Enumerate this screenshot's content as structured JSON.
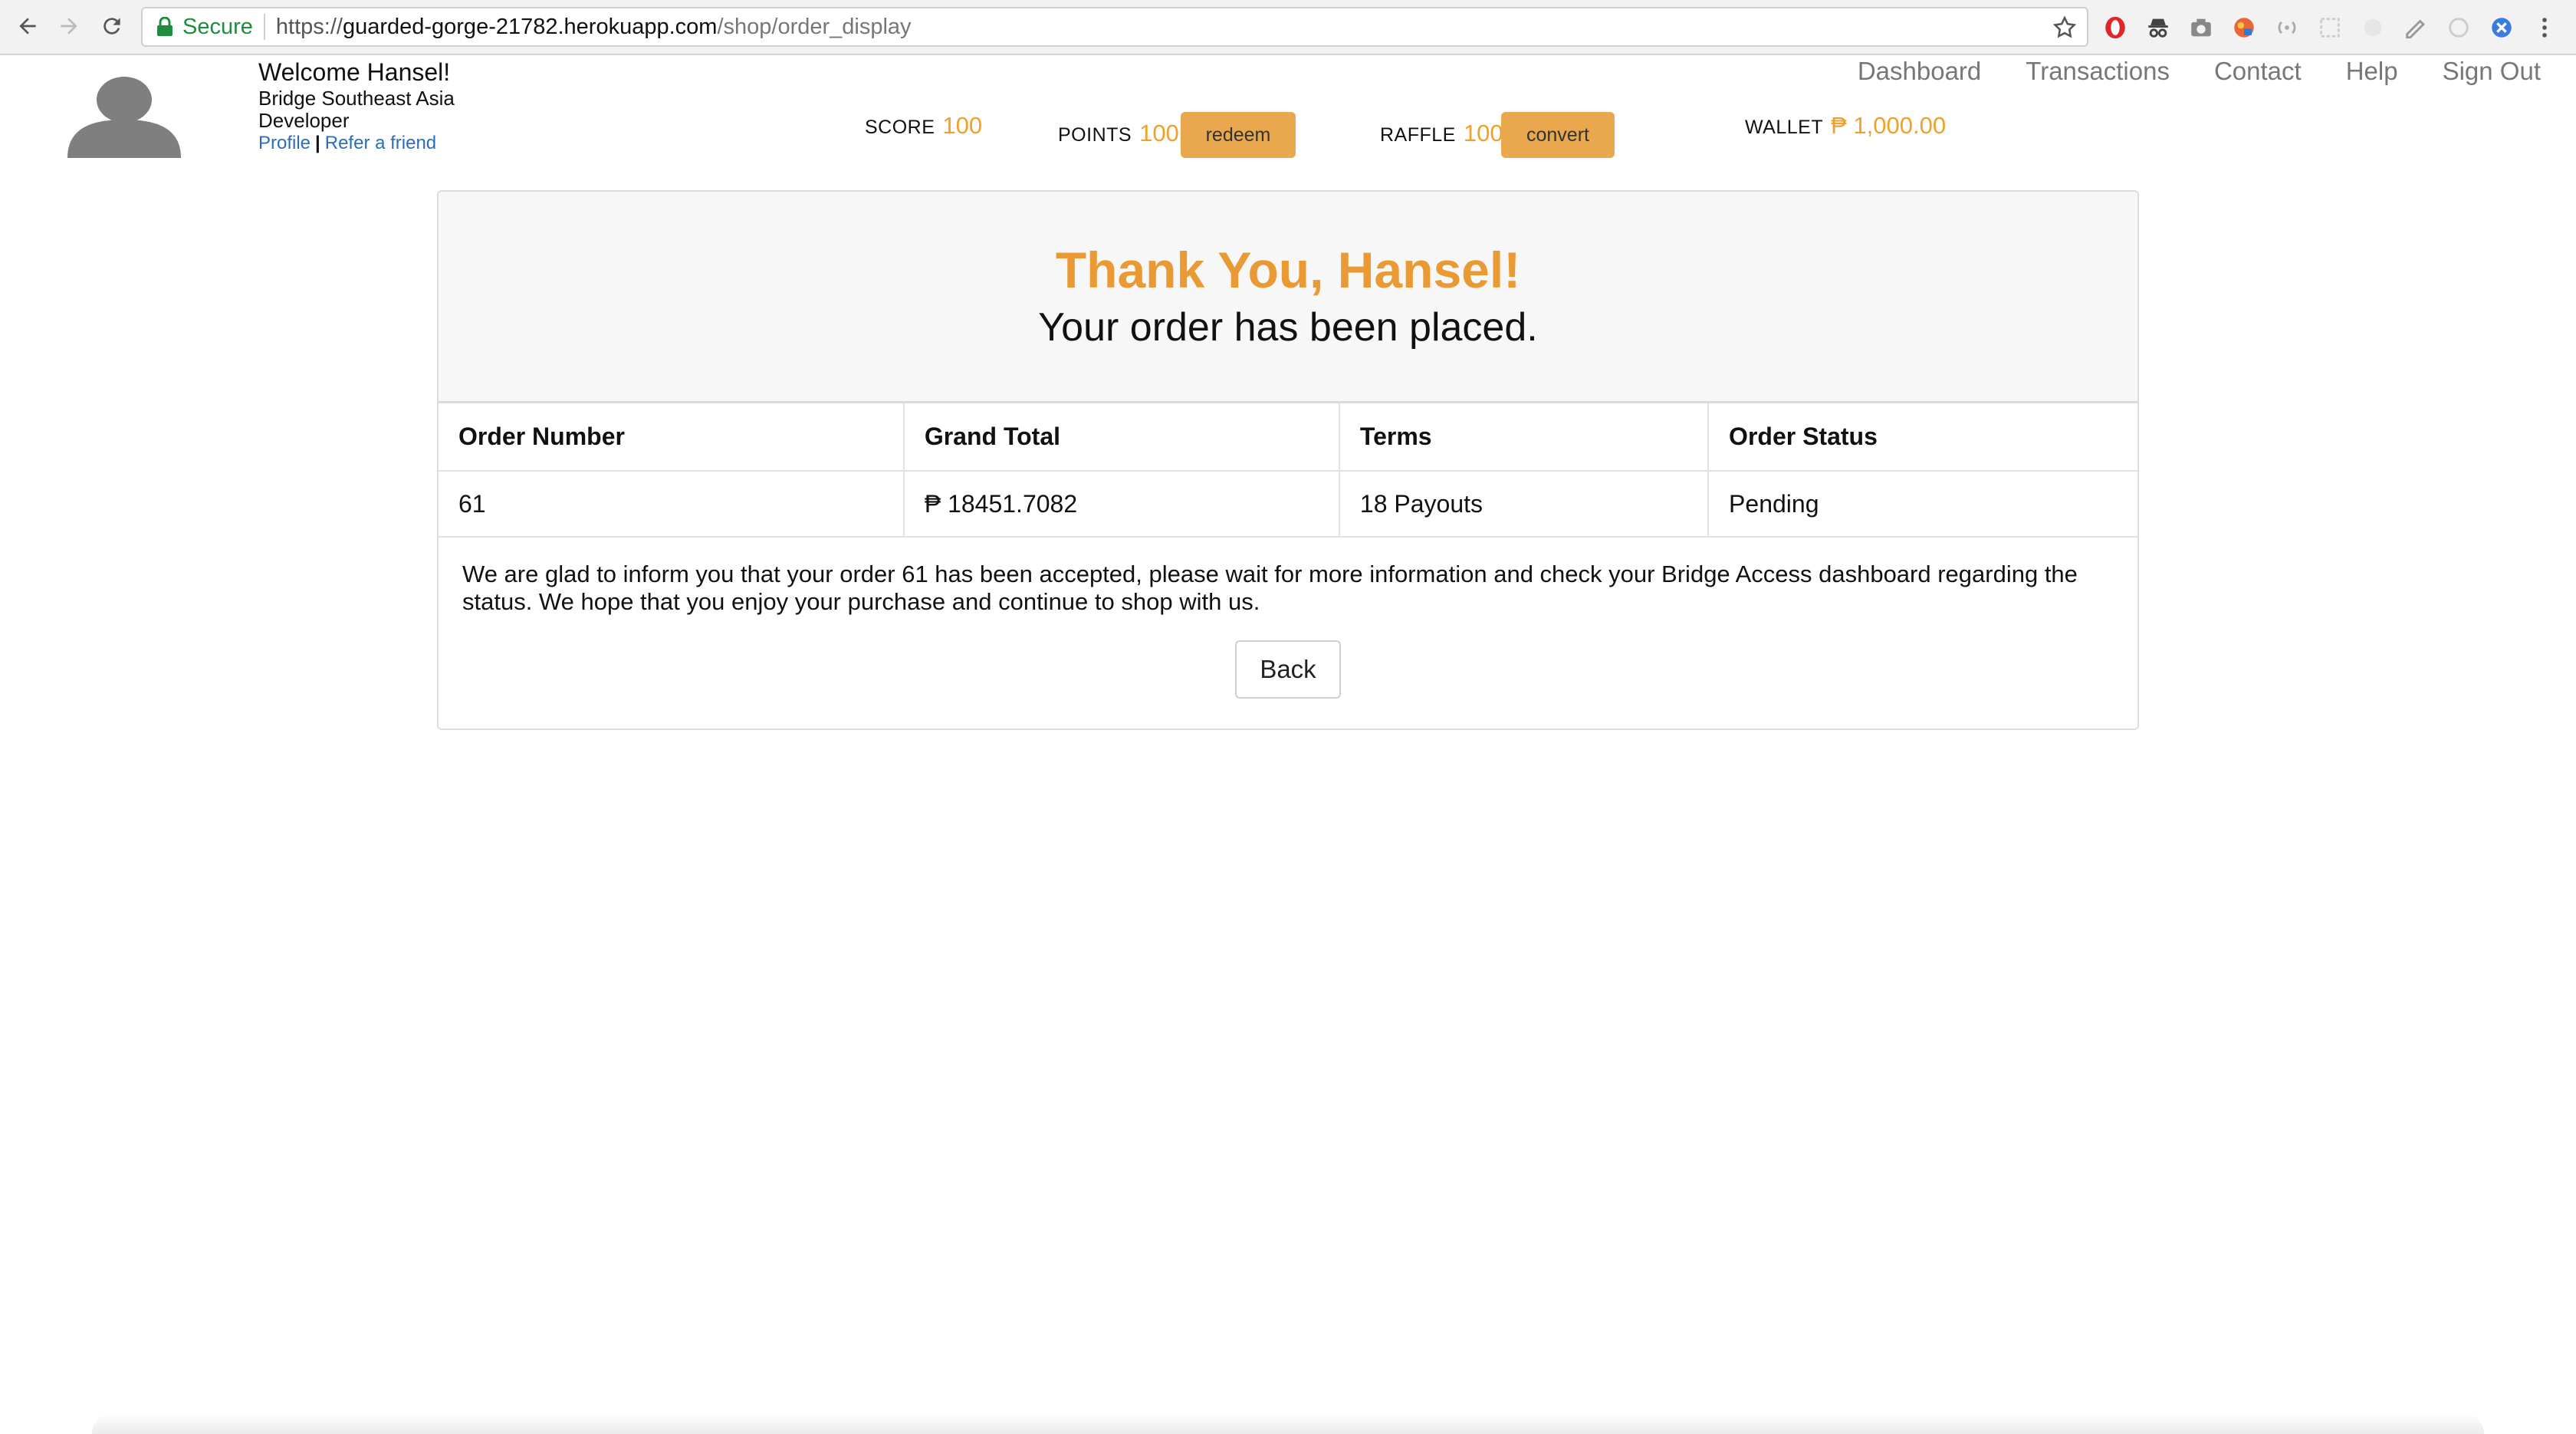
{
  "browser": {
    "secure_label": "Secure",
    "url_scheme": "https://",
    "url_host": "guarded-gorge-21782.herokuapp.com",
    "url_path": "/shop/order_display"
  },
  "header": {
    "welcome": "Welcome Hansel!",
    "company": "Bridge Southeast Asia",
    "role": "Developer",
    "profile_link": "Profile",
    "link_separator": "|",
    "refer_link": "Refer a friend",
    "score_label": "SCORE",
    "score_value": "100",
    "points_label": "POINTS",
    "points_value": "100",
    "redeem_label": "redeem",
    "raffle_label": "RAFFLE",
    "raffle_value": "100",
    "convert_label": "convert",
    "wallet_label": "WALLET",
    "wallet_value": "₱ 1,000.00"
  },
  "nav": {
    "items": [
      "Dashboard",
      "Transactions",
      "Contact",
      "Help",
      "Sign Out"
    ]
  },
  "order": {
    "thanks": "Thank You, Hansel!",
    "placed": "Your order has been placed.",
    "columns": [
      "Order Number",
      "Grand Total",
      "Terms",
      "Order Status"
    ],
    "row": [
      "61",
      "₱ 18451.7082",
      "18 Payouts",
      "Pending"
    ],
    "message": "We are glad to inform you that your order 61 has been accepted, please wait for more information and check your Bridge Access dashboard regarding the status. We hope that you enjoy your purchase and continue to shop with us.",
    "back_label": "Back"
  },
  "colors": {
    "accent": "#e99a35",
    "button": "#e9a84d",
    "link": "#2a6ebb",
    "secure": "#1e8e3e"
  }
}
